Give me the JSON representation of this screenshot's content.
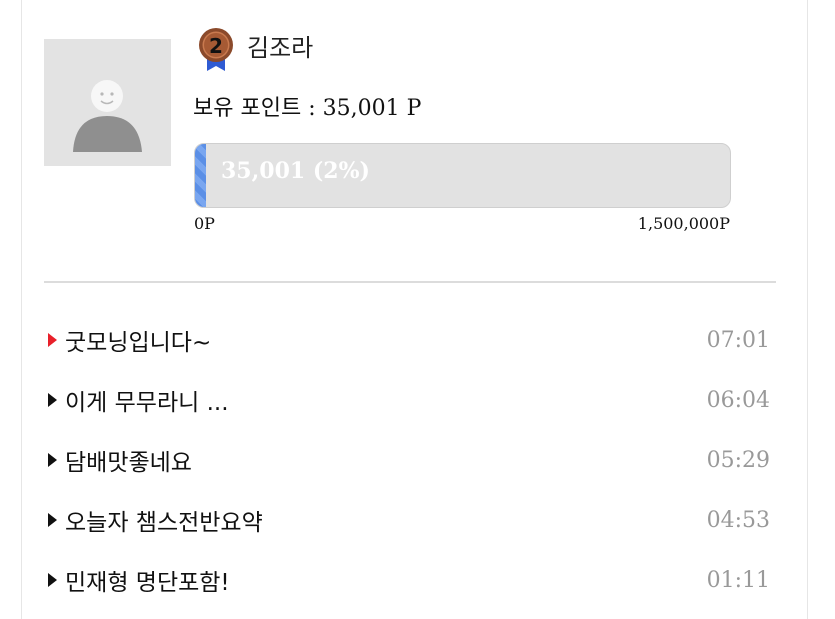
{
  "profile": {
    "username": "김조라",
    "rank_number": "2",
    "points_label": "보유 포인트",
    "points_value": " : 35,001 P"
  },
  "progress": {
    "text": "35,001 (2%)",
    "fraction": 0.02,
    "min_label": "0P",
    "max_label": "1,500,000P",
    "fill_color": "#5b8fe6"
  },
  "posts": [
    {
      "title": "굿모닝입니다~",
      "time": "07:01",
      "is_new": true
    },
    {
      "title": "이게 무무라니 ...",
      "time": "06:04",
      "is_new": false
    },
    {
      "title": "담배맛좋네요",
      "time": "05:29",
      "is_new": false
    },
    {
      "title": "오늘자 챔스전반요약",
      "time": "04:53",
      "is_new": false
    },
    {
      "title": "민재형 명단포함!",
      "time": "01:11",
      "is_new": false
    }
  ],
  "colors": {
    "new_marker": "#e8202a",
    "time_text": "#999999",
    "badge_bronze": "#a0522d",
    "badge_ribbon": "#2f5bd3"
  }
}
